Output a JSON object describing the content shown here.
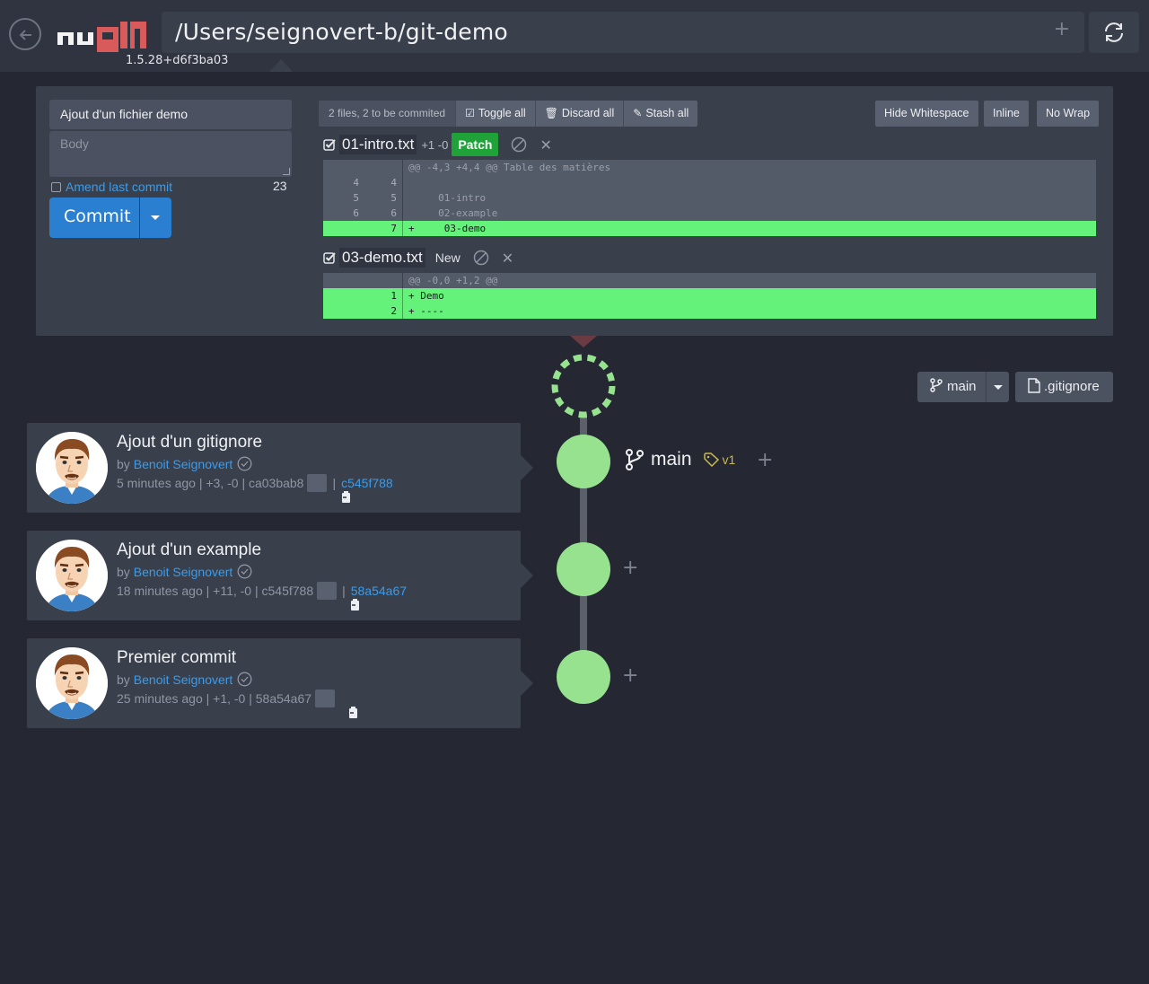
{
  "header": {
    "back_icon": "arrow-left-icon",
    "logo_icon": "ungit-logo",
    "version": "1.5.28+d6f3ba03",
    "path": "/Users/seignovert-b/git-demo",
    "path_add": "+",
    "refresh_icon": "refresh-icon"
  },
  "staging": {
    "title_value": "Ajout d'un fichier demo",
    "body_placeholder": "Body",
    "amend_label": "Amend last commit",
    "char_count": "23",
    "commit_label": "Commit",
    "toolbar": {
      "summary": "2 files, 2 to be commited",
      "toggle_all": "Toggle all",
      "discard_all": "Discard all",
      "stash_all": "Stash all",
      "hide_whitespace": "Hide Whitespace",
      "inline": "Inline",
      "no_wrap": "No Wrap"
    },
    "files": [
      {
        "name": "01-intro.txt",
        "stat": "+1 -0",
        "action": "Patch",
        "diff": [
          {
            "type": "hunk",
            "old": "",
            "new": "",
            "text": "@@ -4,3 +4,4 @@ Table des matières"
          },
          {
            "type": "ctx",
            "old": "4",
            "new": "4",
            "text": ""
          },
          {
            "type": "ctx",
            "old": "5",
            "new": "5",
            "text": "     01-intro"
          },
          {
            "type": "ctx",
            "old": "6",
            "new": "6",
            "text": "     02-example"
          },
          {
            "type": "add",
            "old": "",
            "new": "7",
            "text": "+     03-demo"
          }
        ]
      },
      {
        "name": "03-demo.txt",
        "stat": "",
        "action": "New",
        "diff": [
          {
            "type": "hunk",
            "old": "",
            "new": "",
            "text": "@@ -0,0 +1,2 @@"
          },
          {
            "type": "add",
            "old": "",
            "new": "1",
            "text": "+ Demo"
          },
          {
            "type": "add",
            "old": "",
            "new": "2",
            "text": "+ ----"
          }
        ]
      }
    ]
  },
  "branch_controls": {
    "branch": "main",
    "gitignore": ".gitignore"
  },
  "graph": {
    "head_ref": "main",
    "tag": "v1",
    "add": "+",
    "node_color": "#96e28e"
  },
  "commits": [
    {
      "title": "Ajout d'un gitignore",
      "by": "by",
      "author": "Benoit Seignovert",
      "meta": "5 minutes ago | +3, -0 | ca03bab8",
      "parent_sep": "|",
      "parent": "c545f788"
    },
    {
      "title": "Ajout d'un example",
      "by": "by",
      "author": "Benoit Seignovert",
      "meta": "18 minutes ago | +11, -0 | c545f788",
      "parent_sep": "|",
      "parent": "58a54a67"
    },
    {
      "title": "Premier commit",
      "by": "by",
      "author": "Benoit Seignovert",
      "meta": "25 minutes ago | +1, -0 | 58a54a67",
      "parent_sep": "",
      "parent": ""
    }
  ]
}
